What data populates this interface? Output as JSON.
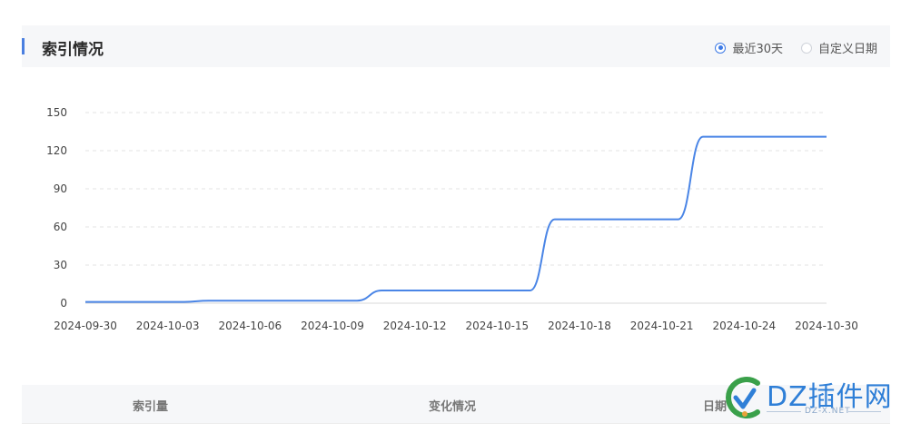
{
  "header": {
    "title": "索引情况",
    "range_options": [
      {
        "label": "最近30天",
        "checked": true
      },
      {
        "label": "自定义日期",
        "checked": false
      }
    ]
  },
  "chart_data": {
    "type": "line",
    "x": [
      "2024-09-30",
      "2024-10-03",
      "2024-10-06",
      "2024-10-09",
      "2024-10-12",
      "2024-10-15",
      "2024-10-18",
      "2024-10-21",
      "2024-10-24",
      "2024-10-30"
    ],
    "series": [
      {
        "points": [
          [
            "2024-09-30",
            1
          ],
          [
            "2024-10-04",
            1
          ],
          [
            "2024-10-05",
            2
          ],
          [
            "2024-10-11",
            2
          ],
          [
            "2024-10-12",
            10
          ],
          [
            "2024-10-18",
            10
          ],
          [
            "2024-10-19",
            66
          ],
          [
            "2024-10-24",
            66
          ],
          [
            "2024-10-25",
            131
          ],
          [
            "2024-10-30",
            131
          ]
        ]
      }
    ],
    "yticks": [
      "150",
      "120",
      "90",
      "60",
      "30",
      "0"
    ],
    "ylim": [
      0,
      150
    ],
    "grid": true,
    "color": "#4a85e6"
  },
  "table": {
    "columns": [
      "索引量",
      "变化情况",
      "日期"
    ]
  },
  "watermark": {
    "text": "DZ插件网",
    "sub": "DZ-X.NET"
  }
}
